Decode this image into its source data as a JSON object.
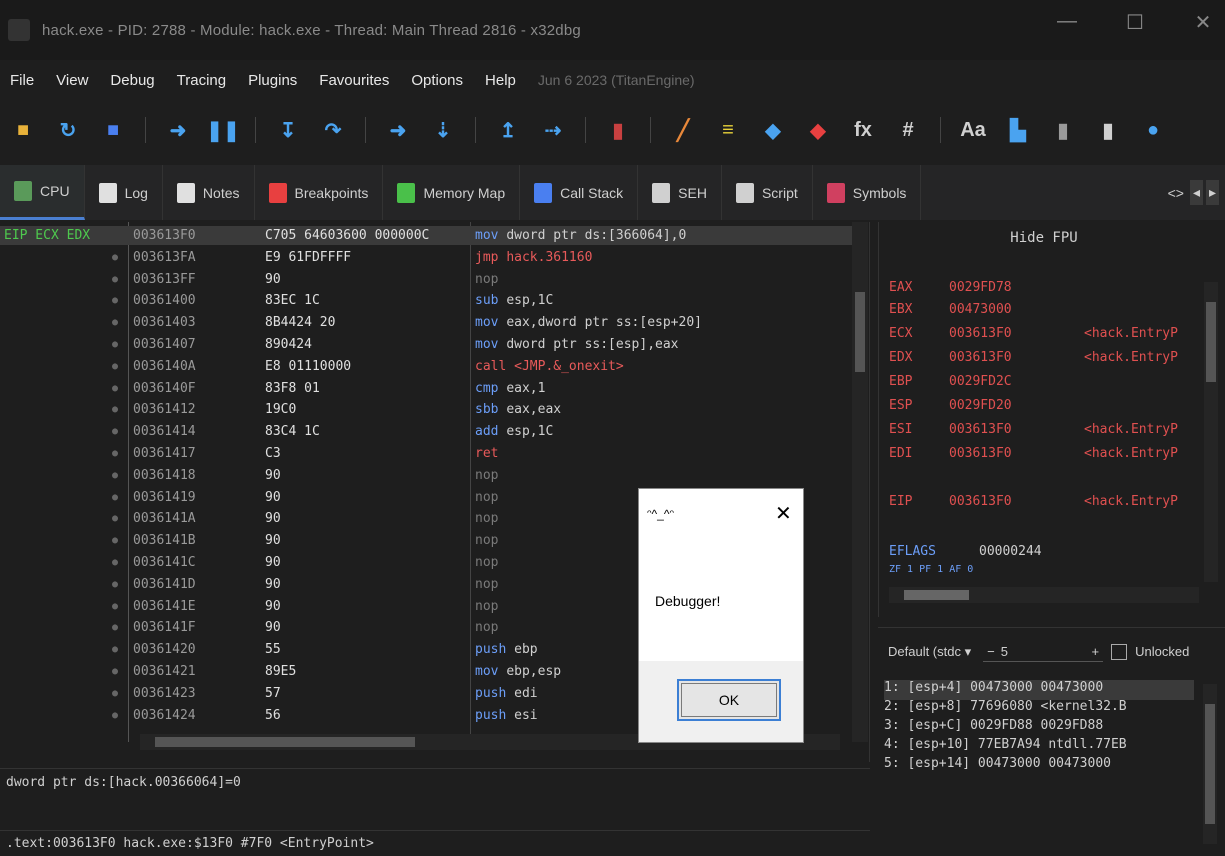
{
  "window": {
    "title": "hack.exe - PID: 2788 - Module: hack.exe - Thread: Main Thread 2816 - x32dbg",
    "minimize": "—",
    "maximize": "☐",
    "close": "✕"
  },
  "menu": {
    "items": [
      "File",
      "View",
      "Debug",
      "Tracing",
      "Plugins",
      "Favourites",
      "Options",
      "Help"
    ],
    "build": "Jun 6 2023 (TitanEngine)"
  },
  "toolbar": {
    "icons": [
      {
        "name": "open-icon",
        "glyph": "■",
        "color": "#e8b23a"
      },
      {
        "name": "restart-icon",
        "glyph": "↻",
        "color": "#4aa3f0"
      },
      {
        "name": "stop-icon",
        "glyph": "■",
        "color": "#4a7ff0"
      },
      {
        "sep": true
      },
      {
        "name": "run-icon",
        "glyph": "➜",
        "color": "#4aa3f0"
      },
      {
        "name": "pause-icon",
        "glyph": "❚❚",
        "color": "#4aa3f0"
      },
      {
        "sep": true
      },
      {
        "name": "step-into-icon",
        "glyph": "↧",
        "color": "#4aa3f0"
      },
      {
        "name": "step-over-icon",
        "glyph": "↷",
        "color": "#4aa3f0"
      },
      {
        "sep": true
      },
      {
        "name": "trace-into-icon",
        "glyph": "➜",
        "color": "#4aa3f0"
      },
      {
        "name": "trace-over-icon",
        "glyph": "⇣",
        "color": "#4aa3f0"
      },
      {
        "sep": true
      },
      {
        "name": "execute-till-return-icon",
        "glyph": "↥",
        "color": "#4aa3f0"
      },
      {
        "name": "run-to-user-code-icon",
        "glyph": "⇢",
        "color": "#4aa3f0"
      },
      {
        "sep": true
      },
      {
        "name": "scylla-icon",
        "glyph": "▮",
        "color": "#c84040"
      },
      {
        "sep": true
      },
      {
        "name": "patch-icon",
        "glyph": "╱",
        "color": "#e8883a"
      },
      {
        "name": "comments-icon",
        "glyph": "≡",
        "color": "#e8d23a"
      },
      {
        "name": "labels-icon",
        "glyph": "◆",
        "color": "#4aa3f0"
      },
      {
        "name": "bookmarks-icon",
        "glyph": "◆",
        "color": "#e84040"
      },
      {
        "name": "functions-icon",
        "glyph": "fx",
        "color": "#d0d0d0"
      },
      {
        "name": "hash-icon",
        "glyph": "#",
        "color": "#d0d0d0"
      },
      {
        "sep": true
      },
      {
        "name": "strings-icon",
        "glyph": "Aa",
        "color": "#d0d0d0"
      },
      {
        "name": "calculator-icon",
        "glyph": "▙",
        "color": "#4aa3f0"
      },
      {
        "name": "cheatsheet-icon",
        "glyph": "▮",
        "color": "#9a9a9a"
      },
      {
        "name": "help-icon",
        "glyph": "▮",
        "color": "#d0d0d0"
      },
      {
        "name": "bulb-icon",
        "glyph": "●",
        "color": "#4aa3f0"
      }
    ]
  },
  "tabs": [
    {
      "name": "tab-cpu",
      "label": "CPU",
      "color": "#5a9a5a",
      "active": true
    },
    {
      "name": "tab-log",
      "label": "Log",
      "color": "#e0e0e0"
    },
    {
      "name": "tab-notes",
      "label": "Notes",
      "color": "#e0e0e0"
    },
    {
      "name": "tab-breakpoints",
      "label": "Breakpoints",
      "color": "#e84040"
    },
    {
      "name": "tab-memory-map",
      "label": "Memory Map",
      "color": "#4ac04a"
    },
    {
      "name": "tab-call-stack",
      "label": "Call Stack",
      "color": "#4a7ff0"
    },
    {
      "name": "tab-seh",
      "label": "SEH",
      "color": "#d0d0d0"
    },
    {
      "name": "tab-script",
      "label": "Script",
      "color": "#d0d0d0"
    },
    {
      "name": "tab-symbols",
      "label": "Symbols",
      "color": "#d04060"
    }
  ],
  "tab_nav": {
    "source": "<>",
    "left": "◂",
    "right": "▸"
  },
  "disasm": {
    "label_row": "EIP ECX EDX",
    "rows": [
      {
        "addr": "003613F0",
        "bytes": "C705 64603600 000000C",
        "mn": "mov",
        "op": "dword ptr ds:[366064],0",
        "cls": "mn-mov",
        "sel": true
      },
      {
        "addr": "003613FA",
        "bytes": "E9 61FDFFFF",
        "mn": "jmp",
        "op": "hack.361160",
        "cls": "mn-jmp"
      },
      {
        "addr": "003613FF",
        "bytes": "90",
        "mn": "nop",
        "op": "",
        "cls": "mn-nop"
      },
      {
        "addr": "00361400",
        "bytes": "83EC 1C",
        "mn": "sub",
        "op": "esp,1C",
        "cls": "mn-mov"
      },
      {
        "addr": "00361403",
        "bytes": "8B4424 20",
        "mn": "mov",
        "op": "eax,dword ptr ss:[esp+20]",
        "cls": "mn-mov"
      },
      {
        "addr": "00361407",
        "bytes": "890424",
        "mn": "mov",
        "op": "dword ptr ss:[esp],eax",
        "cls": "mn-mov"
      },
      {
        "addr": "0036140A",
        "bytes": "E8 01110000",
        "mn": "call",
        "op": "<JMP.&_onexit>",
        "cls": "mn-call"
      },
      {
        "addr": "0036140F",
        "bytes": "83F8 01",
        "mn": "cmp",
        "op": "eax,1",
        "cls": "mn-cmp"
      },
      {
        "addr": "00361412",
        "bytes": "19C0",
        "mn": "sbb",
        "op": "eax,eax",
        "cls": "mn-mov"
      },
      {
        "addr": "00361414",
        "bytes": "83C4 1C",
        "mn": "add",
        "op": "esp,1C",
        "cls": "mn-mov"
      },
      {
        "addr": "00361417",
        "bytes": "C3",
        "mn": "ret",
        "op": "",
        "cls": "mn-ret"
      },
      {
        "addr": "00361418",
        "bytes": "90",
        "mn": "nop",
        "op": "",
        "cls": "mn-nop"
      },
      {
        "addr": "00361419",
        "bytes": "90",
        "mn": "nop",
        "op": "",
        "cls": "mn-nop"
      },
      {
        "addr": "0036141A",
        "bytes": "90",
        "mn": "nop",
        "op": "",
        "cls": "mn-nop"
      },
      {
        "addr": "0036141B",
        "bytes": "90",
        "mn": "nop",
        "op": "",
        "cls": "mn-nop"
      },
      {
        "addr": "0036141C",
        "bytes": "90",
        "mn": "nop",
        "op": "",
        "cls": "mn-nop"
      },
      {
        "addr": "0036141D",
        "bytes": "90",
        "mn": "nop",
        "op": "",
        "cls": "mn-nop"
      },
      {
        "addr": "0036141E",
        "bytes": "90",
        "mn": "nop",
        "op": "",
        "cls": "mn-nop"
      },
      {
        "addr": "0036141F",
        "bytes": "90",
        "mn": "nop",
        "op": "",
        "cls": "mn-nop"
      },
      {
        "addr": "00361420",
        "bytes": "55",
        "mn": "push",
        "op": "ebp",
        "cls": "mn-mov"
      },
      {
        "addr": "00361421",
        "bytes": "89E5",
        "mn": "mov",
        "op": "ebp,esp",
        "cls": "mn-mov"
      },
      {
        "addr": "00361423",
        "bytes": "57",
        "mn": "push",
        "op": "edi",
        "cls": "mn-mov"
      },
      {
        "addr": "00361424",
        "bytes": "56",
        "mn": "push",
        "op": "esi",
        "cls": "mn-mov"
      }
    ]
  },
  "info_line": "dword ptr ds:[hack.00366064]=0",
  "status_line": ".text:003613F0 hack.exe:$13F0 #7F0 <EntryPoint>",
  "registers": {
    "header": "Hide FPU",
    "rows": [
      {
        "name": "EAX",
        "val": "0029FD78",
        "cmt": ""
      },
      {
        "name": "EBX",
        "val": "00473000",
        "cmt": ""
      },
      {
        "name": "ECX",
        "val": "003613F0",
        "cmt": "<hack.EntryP"
      },
      {
        "name": "EDX",
        "val": "003613F0",
        "cmt": "<hack.EntryP"
      },
      {
        "name": "EBP",
        "val": "0029FD2C",
        "cmt": ""
      },
      {
        "name": "ESP",
        "val": "0029FD20",
        "cmt": ""
      },
      {
        "name": "ESI",
        "val": "003613F0",
        "cmt": "<hack.EntryP"
      },
      {
        "name": "EDI",
        "val": "003613F0",
        "cmt": "<hack.EntryP"
      },
      {
        "name": "EIP",
        "val": "003613F0",
        "cmt": "<hack.EntryP"
      },
      {
        "name": "EFLAGS",
        "val": "00000244",
        "cmt": ""
      }
    ],
    "flags_line": "ZF 1  PF 1  AF 0"
  },
  "stack_ctl": {
    "convention": "Default (stdc",
    "dropdown": "▾",
    "minus": "−",
    "count": "5",
    "plus": "+",
    "unlocked": "Unlocked"
  },
  "stack": {
    "rows": [
      {
        "text": "1: [esp+4]  00473000 00473000",
        "sel": true
      },
      {
        "text": "2: [esp+8]  77696080 <kernel32.B"
      },
      {
        "text": "3: [esp+C]  0029FD88 0029FD88"
      },
      {
        "text": "4: [esp+10] 77EB7A94 ntdll.77EB"
      },
      {
        "text": "5: [esp+14] 00473000 00473000"
      }
    ]
  },
  "dialog": {
    "title": "ᵔ^_^ᵔ",
    "close": "✕",
    "message": "Debugger!",
    "ok": "OK"
  }
}
